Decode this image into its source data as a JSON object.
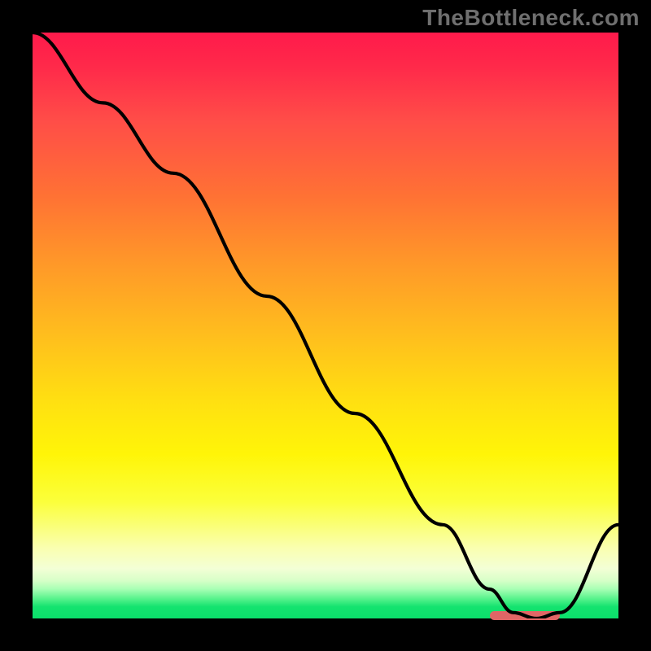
{
  "watermark": "TheBottleneck.com",
  "colors": {
    "gradient_top": "#ff1a4b",
    "gradient_mid1": "#ff9a28",
    "gradient_mid2": "#ffe011",
    "gradient_pale": "#faffb0",
    "gradient_bottom": "#0be06b",
    "curve": "#000000",
    "marker": "#e06666",
    "frame": "#000000"
  },
  "chart_data": {
    "type": "line",
    "title": "",
    "xlabel": "",
    "ylabel": "",
    "xlim": [
      0,
      100
    ],
    "ylim": [
      0,
      100
    ],
    "grid": false,
    "series": [
      {
        "name": "bottleneck-curve",
        "x": [
          0,
          12,
          24,
          40,
          55,
          70,
          78,
          82,
          86,
          90,
          100
        ],
        "values": [
          100,
          88,
          76,
          55,
          35,
          16,
          5,
          1,
          0,
          1,
          16
        ]
      }
    ],
    "annotations": [
      {
        "name": "optimal-range-marker",
        "x_start": 78,
        "x_end": 90,
        "y": 0.6
      }
    ]
  }
}
